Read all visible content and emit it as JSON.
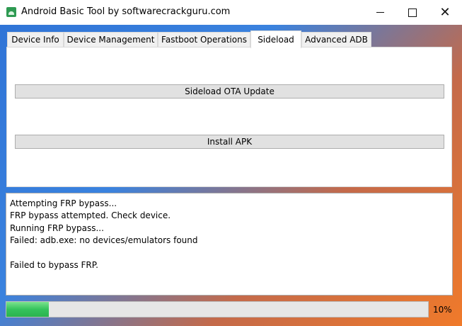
{
  "window": {
    "title": "Android Basic Tool by softwarecrackguru.com",
    "controls": {
      "minimize": "minimize",
      "maximize": "maximize",
      "close": "✕"
    }
  },
  "tabs": [
    {
      "label": "Device Info",
      "active": false
    },
    {
      "label": "Device Management",
      "active": false
    },
    {
      "label": "Fastboot Operations",
      "active": false
    },
    {
      "label": "Sideload",
      "active": true
    },
    {
      "label": "Advanced ADB",
      "active": false
    }
  ],
  "sideload": {
    "buttons": [
      {
        "label": "Sideload OTA Update"
      },
      {
        "label": "Install APK"
      }
    ]
  },
  "log": {
    "lines": [
      "Attempting FRP bypass...",
      "FRP bypass attempted. Check device.",
      "Running FRP bypass...",
      "Failed: adb.exe: no devices/emulators found",
      "",
      "Failed to bypass FRP."
    ]
  },
  "progress": {
    "value": 0.1,
    "label": "10%"
  },
  "colors": {
    "progress_fill": "#35c35c",
    "accent": "#2f73d6"
  }
}
